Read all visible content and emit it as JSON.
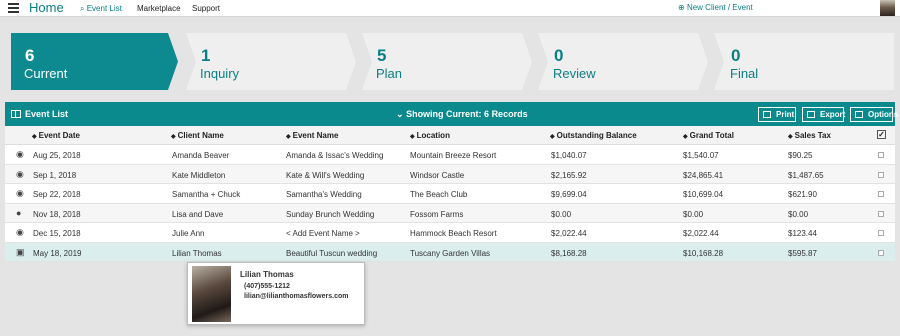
{
  "header": {
    "app_title": "Home",
    "nav": [
      {
        "label": "Event List",
        "icon": "tag-icon"
      },
      {
        "label": "Marketplace"
      },
      {
        "label": "Support"
      }
    ],
    "new_client_label": "New Client / Event"
  },
  "pipeline": [
    {
      "count": "6",
      "label": "Current",
      "active": true
    },
    {
      "count": "1",
      "label": "Inquiry",
      "active": false
    },
    {
      "count": "5",
      "label": "Plan",
      "active": false
    },
    {
      "count": "0",
      "label": "Review",
      "active": false
    },
    {
      "count": "0",
      "label": "Final",
      "active": false
    }
  ],
  "list": {
    "title": "Event List",
    "showing": "Showing Current: 6 Records",
    "buttons": {
      "print": "Print",
      "export": "Export",
      "options": "Options"
    }
  },
  "table": {
    "columns": [
      "Event Date",
      "Client Name",
      "Event Name",
      "Location",
      "Outstanding Balance",
      "Grand Total",
      "Sales Tax"
    ],
    "rows": [
      {
        "icon": "eye-icon",
        "icon_glyph": "◉",
        "date": "Aug 25, 2018",
        "client": "Amanda Beaver",
        "event": "Amanda & Issac's Wedding",
        "location": "Mountain Breeze Resort",
        "balance": "$1,040.07",
        "grand_total": "$1,540.07",
        "sales_tax": "$90.25"
      },
      {
        "icon": "eye-icon",
        "icon_glyph": "◉",
        "date": "Sep 1, 2018",
        "client": "Kate Middleton",
        "event": "Kate & Will's Wedding",
        "location": "Windsor Castle",
        "balance": "$2,165.92",
        "grand_total": "$24,865.41",
        "sales_tax": "$1,487.65"
      },
      {
        "icon": "eye-icon",
        "icon_glyph": "◉",
        "date": "Sep 22, 2018",
        "client": "Samantha + Chuck",
        "event": "Samantha's Wedding",
        "location": "The Beach Club",
        "balance": "$9,699.04",
        "grand_total": "$10,699.04",
        "sales_tax": "$621.90"
      },
      {
        "icon": "chat-icon",
        "icon_glyph": "●",
        "date": "Nov 18, 2018",
        "client": "Lisa and Dave",
        "event": "Sunday Brunch Wedding",
        "location": "Fossom Farms",
        "balance": "$0.00",
        "grand_total": "$0.00",
        "sales_tax": "$0.00"
      },
      {
        "icon": "eye-icon",
        "icon_glyph": "◉",
        "date": "Dec 15, 2018",
        "client": "Julie Ann",
        "event": "< Add Event Name >",
        "location": "Hammock Beach Resort",
        "balance": "$2,022.44",
        "grand_total": "$2,022.44",
        "sales_tax": "$123.44"
      },
      {
        "icon": "money-icon",
        "icon_glyph": "▣",
        "date": "May 18, 2019",
        "client": "Lilian Thomas",
        "event": "Beautiful Tuscun wedding",
        "location": "Tuscany Garden Villas",
        "balance": "$8,168.28",
        "grand_total": "$10,168.28",
        "sales_tax": "$595.87"
      }
    ]
  },
  "popover": {
    "name": "Lilian Thomas",
    "phone": "(407)555-1212",
    "email": "lilian@lilianthomasflowers.com"
  },
  "colors": {
    "accent": "#0b8a8e",
    "highlight_row": "#dbeeee"
  }
}
